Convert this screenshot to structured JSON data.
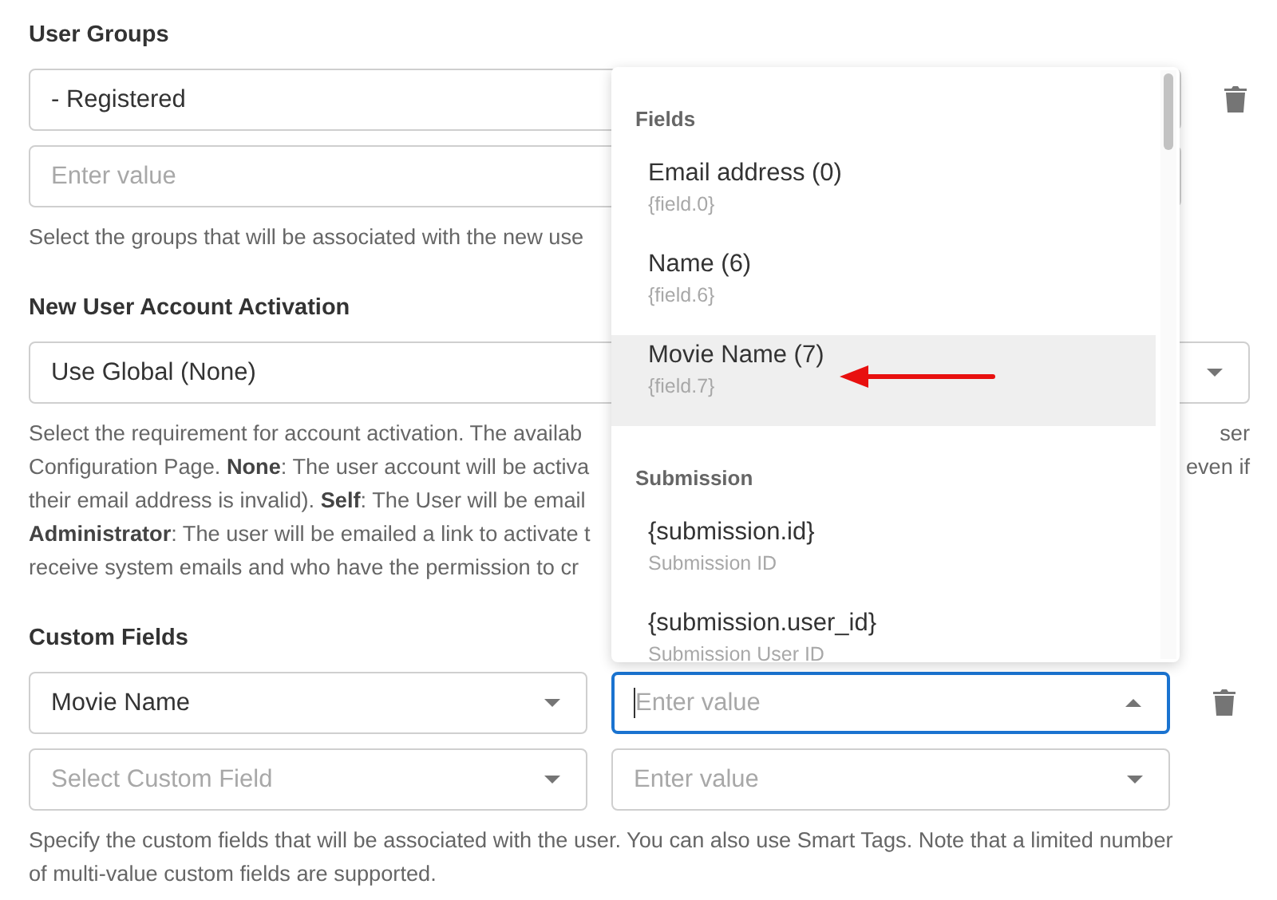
{
  "sections": [
    {
      "label": "User Groups",
      "rows": [
        {
          "fields": [
            {
              "kind": "text",
              "value": "- Registered",
              "focused": false
            }
          ],
          "trash": true
        },
        {
          "fields": [
            {
              "kind": "text",
              "placeholder": "Enter value",
              "focused": false
            }
          ],
          "trash": false
        }
      ],
      "help": [
        {
          "left": "Select the groups that will be associated with the new use"
        }
      ]
    },
    {
      "label": "New User Account Activation",
      "rows": [
        {
          "fields": [
            {
              "kind": "select",
              "value": "Use Global (None)",
              "focused": false
            }
          ],
          "trash": false
        }
      ],
      "help": [
        {
          "left": "Select the requirement for account activation. The availab",
          "right": "ser"
        },
        {
          "left": "Configuration Page. **None**: The user account will be activa",
          "right": "even if"
        },
        {
          "left": "their email address is invalid). **Self**: The User will be email"
        },
        {
          "left": "**Administrator**: The user will be emailed a link to activate t"
        },
        {
          "left": "receive system emails and who have the permission to cr"
        }
      ]
    },
    {
      "label": "Custom Fields",
      "rows": [
        {
          "fields": [
            {
              "kind": "select",
              "value": "Movie Name",
              "focused": false
            },
            {
              "kind": "select",
              "placeholder": "Enter value",
              "focused": true
            }
          ],
          "trash": true
        },
        {
          "fields": [
            {
              "kind": "select",
              "placeholder": "Select Custom Field",
              "focused": false
            },
            {
              "kind": "select",
              "placeholder": "Enter value",
              "focused": false
            }
          ],
          "trash": false
        }
      ],
      "help": [
        {
          "left": "Specify the custom fields that will be associated with the user. You can also use Smart Tags. Note that a limited number"
        },
        {
          "left": "of multi-value custom fields are supported."
        }
      ]
    }
  ],
  "dropdown": {
    "groups": [
      {
        "title": "Fields",
        "items": [
          {
            "label": "Email address (0)",
            "sublabel": "{field.0}",
            "selected": false,
            "arrow": false
          },
          {
            "label": "Name (6)",
            "sublabel": "{field.6}",
            "selected": false,
            "arrow": false
          },
          {
            "label": "Movie Name (7)",
            "sublabel": "{field.7}",
            "selected": true,
            "arrow": true
          }
        ]
      },
      {
        "title": "Submission",
        "items": [
          {
            "label": "{submission.id}",
            "sublabel": "Submission ID",
            "selected": false,
            "arrow": false
          },
          {
            "label": "{submission.user_id}",
            "sublabel": "Submission User ID",
            "selected": false,
            "arrow": false
          }
        ]
      }
    ]
  }
}
